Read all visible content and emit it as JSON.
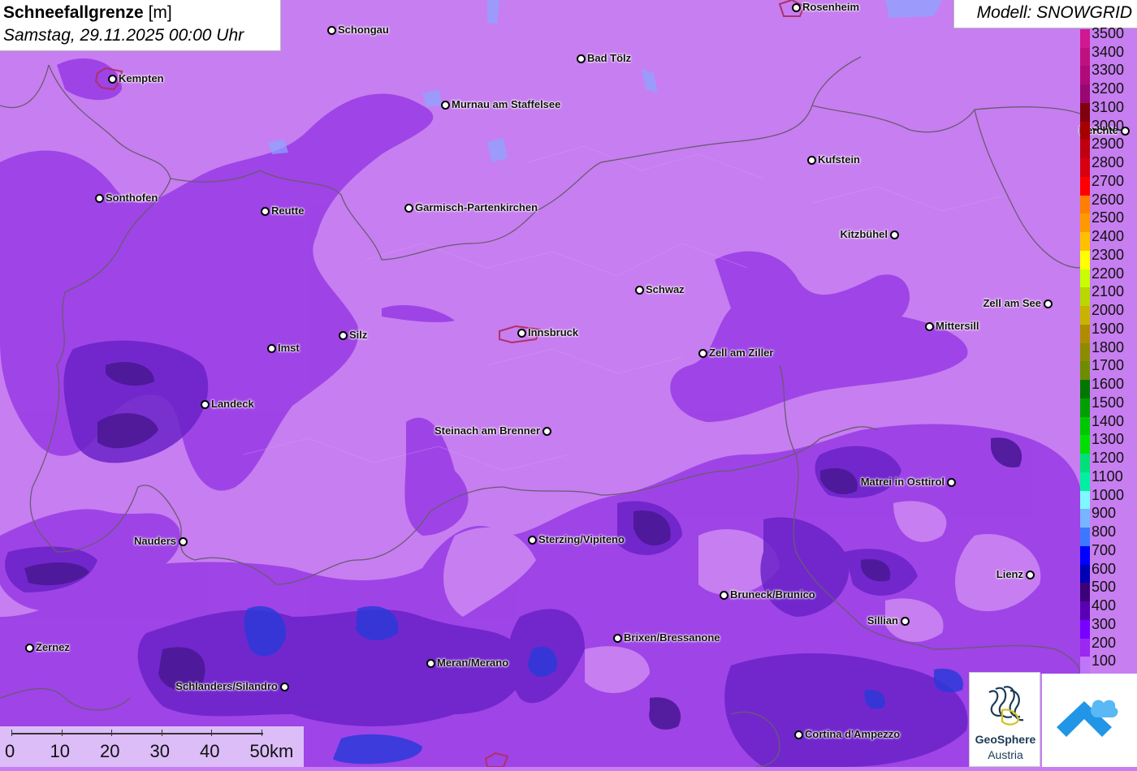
{
  "title": {
    "parameter": "Schneefallgrenze",
    "unit": "[m]",
    "datetime": "Samstag, 29.11.2025 00:00 Uhr"
  },
  "model": "Modell: SNOWGRID",
  "colors": {
    "background": "#c77ef0",
    "low_zone": "#9a3ee6",
    "mid_zone": "#6a22c8",
    "deep_zone": "#4b1896",
    "blue_zone": "#2b3ad8"
  },
  "legend": [
    {
      "label": "3500",
      "color": "#d01890"
    },
    {
      "label": "3400",
      "color": "#c01080"
    },
    {
      "label": "3300",
      "color": "#b00a78"
    },
    {
      "label": "3200",
      "color": "#980870"
    },
    {
      "label": "3100",
      "color": "#800010"
    },
    {
      "label": "3000",
      "color": "#a80000"
    },
    {
      "label": "2900",
      "color": "#c00010"
    },
    {
      "label": "2800",
      "color": "#d80010"
    },
    {
      "label": "2700",
      "color": "#ff0000"
    },
    {
      "label": "2600",
      "color": "#ff7f00"
    },
    {
      "label": "2500",
      "color": "#ff9900"
    },
    {
      "label": "2400",
      "color": "#ffc000"
    },
    {
      "label": "2300",
      "color": "#ffff00"
    },
    {
      "label": "2200",
      "color": "#c8ff00"
    },
    {
      "label": "2100",
      "color": "#b8d800"
    },
    {
      "label": "2000",
      "color": "#c8b400"
    },
    {
      "label": "1900",
      "color": "#b08c00"
    },
    {
      "label": "1800",
      "color": "#8c8c00"
    },
    {
      "label": "1700",
      "color": "#6e8c00"
    },
    {
      "label": "1600",
      "color": "#007800"
    },
    {
      "label": "1500",
      "color": "#00a000"
    },
    {
      "label": "1400",
      "color": "#00c800"
    },
    {
      "label": "1300",
      "color": "#00e000"
    },
    {
      "label": "1200",
      "color": "#00e078"
    },
    {
      "label": "1100",
      "color": "#00f0a0"
    },
    {
      "label": "1000",
      "color": "#7ff8ff"
    },
    {
      "label": "900",
      "color": "#78b4ff"
    },
    {
      "label": "800",
      "color": "#3c78ff"
    },
    {
      "label": "700",
      "color": "#0000ff"
    },
    {
      "label": "600",
      "color": "#0000b4"
    },
    {
      "label": "500",
      "color": "#3c0078"
    },
    {
      "label": "400",
      "color": "#5a00b4"
    },
    {
      "label": "300",
      "color": "#7800ff"
    },
    {
      "label": "200",
      "color": "#9a28f0"
    },
    {
      "label": "100",
      "color": "#c074f8"
    }
  ],
  "cities": [
    {
      "name": "Rosenheim"
    },
    {
      "name": "Schongau"
    },
    {
      "name": "Kempten"
    },
    {
      "name": "Bad Tölz"
    },
    {
      "name": "Murnau am Staffelsee"
    },
    {
      "name": "Berchte"
    },
    {
      "name": "Kufstein"
    },
    {
      "name": "Sonthofen"
    },
    {
      "name": "Reutte"
    },
    {
      "name": "Garmisch-Partenkirchen"
    },
    {
      "name": "Kitzbühel"
    },
    {
      "name": "Schwaz"
    },
    {
      "name": "Zell am See"
    },
    {
      "name": "Mittersill"
    },
    {
      "name": "Innsbruck"
    },
    {
      "name": "Silz"
    },
    {
      "name": "Imst"
    },
    {
      "name": "Zell am Ziller"
    },
    {
      "name": "Landeck"
    },
    {
      "name": "Steinach am Brenner"
    },
    {
      "name": "Matrei in Osttirol"
    },
    {
      "name": "Nauders"
    },
    {
      "name": "Sterzing/Vipiteno"
    },
    {
      "name": "Lienz"
    },
    {
      "name": "Bruneck/Brunico"
    },
    {
      "name": "Sillian"
    },
    {
      "name": "Brixen/Bressanone"
    },
    {
      "name": "Zernez"
    },
    {
      "name": "Meran/Merano"
    },
    {
      "name": "Schlanders/Silandro"
    },
    {
      "name": "Cortina d'Ampezzo"
    }
  ],
  "scale": {
    "labels": [
      "0",
      "10",
      "20",
      "30",
      "40",
      "50km"
    ]
  },
  "logos": {
    "geosphere_name": "GeoSphere",
    "geosphere_sub": "Austria",
    "geosphere_icon": "geosphere-swirl-icon",
    "cloud_icon": "cloud-mountain-icon"
  }
}
